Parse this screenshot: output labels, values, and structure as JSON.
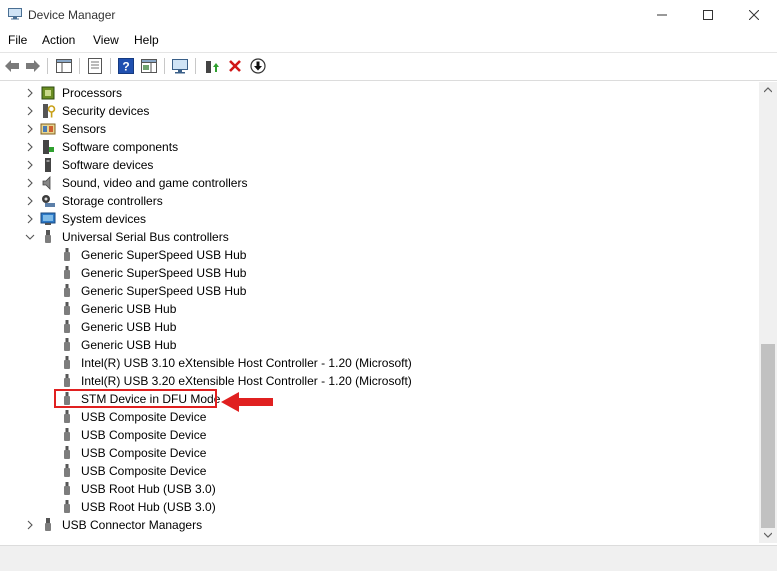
{
  "window": {
    "title": "Device Manager",
    "minimize_icon": "minimize-icon",
    "maximize_icon": "maximize-icon",
    "close_icon": "close-icon"
  },
  "menu": [
    {
      "label": "File"
    },
    {
      "label": "Action"
    },
    {
      "label": "View"
    },
    {
      "label": "Help"
    }
  ],
  "toolbar": {
    "buttons": [
      "back-icon",
      "forward-icon",
      "show-hide-console-tree-icon",
      "properties-icon",
      "help-icon",
      "action-pane-icon",
      "scan-hardware-icon",
      "update-driver-icon",
      "uninstall-icon",
      "disable-device-icon"
    ]
  },
  "tree": {
    "categories_before": [
      {
        "label": "Processors",
        "icon": "processor-icon"
      },
      {
        "label": "Security devices",
        "icon": "security-device-icon"
      },
      {
        "label": "Sensors",
        "icon": "sensor-icon"
      },
      {
        "label": "Software components",
        "icon": "software-component-icon"
      },
      {
        "label": "Software devices",
        "icon": "software-device-icon"
      },
      {
        "label": "Sound, video and game controllers",
        "icon": "speaker-icon"
      },
      {
        "label": "Storage controllers",
        "icon": "storage-controller-icon"
      },
      {
        "label": "System devices",
        "icon": "system-device-icon"
      }
    ],
    "expanded_category": {
      "label": "Universal Serial Bus controllers",
      "icon": "usb-icon"
    },
    "usb_children": [
      {
        "label": "Generic SuperSpeed USB Hub"
      },
      {
        "label": "Generic SuperSpeed USB Hub"
      },
      {
        "label": "Generic SuperSpeed USB Hub"
      },
      {
        "label": "Generic USB Hub"
      },
      {
        "label": "Generic USB Hub"
      },
      {
        "label": "Generic USB Hub"
      },
      {
        "label": "Intel(R) USB 3.10 eXtensible Host Controller - 1.20 (Microsoft)"
      },
      {
        "label": "Intel(R) USB 3.20 eXtensible Host Controller - 1.20 (Microsoft)"
      },
      {
        "label": "STM Device in DFU Mode",
        "highlighted": true
      },
      {
        "label": "USB Composite Device"
      },
      {
        "label": "USB Composite Device"
      },
      {
        "label": "USB Composite Device"
      },
      {
        "label": "USB Composite Device"
      },
      {
        "label": "USB Root Hub (USB 3.0)"
      },
      {
        "label": "USB Root Hub (USB 3.0)"
      }
    ],
    "categories_after": [
      {
        "label": "USB Connector Managers",
        "icon": "usb-icon"
      }
    ]
  },
  "annotation": {
    "color": "#e02020",
    "arrow_icon": "red-arrow-icon"
  }
}
